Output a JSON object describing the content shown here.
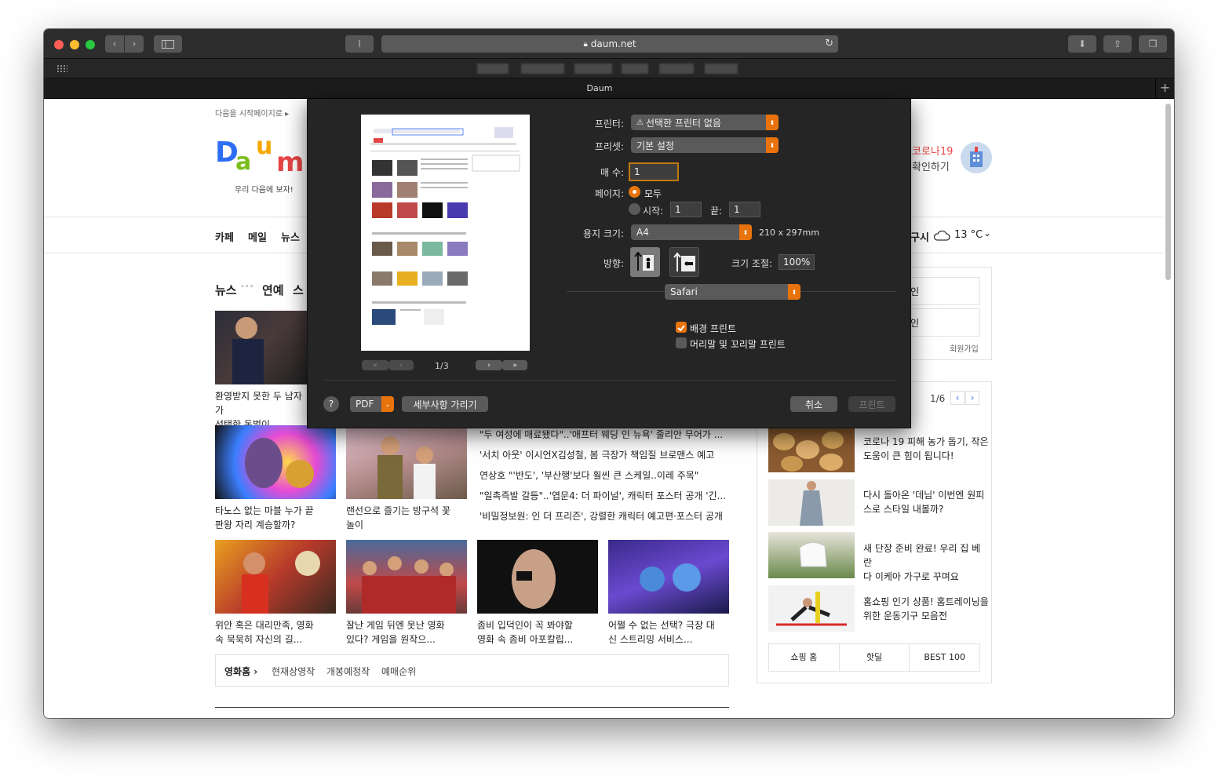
{
  "browser": {
    "address": "daum.net",
    "tab_title": "Daum",
    "new_tab_symbol": "+"
  },
  "daum": {
    "start_page_link": "다음을 시작페이지로",
    "slogan": "우리 다음에 보자!",
    "nav": [
      "카페",
      "메일",
      "뉴스"
    ],
    "covid_title": "코로나19",
    "covid_sub": "확인하기",
    "weather_city": "구시",
    "weather_temp": "13 °C",
    "section_tabs": [
      "뉴스",
      "연예",
      "스"
    ],
    "captions": [
      "환영받지 못한 두 남자가 선택한 돈벌이",
      "타노스 없는 마블 누가 끝판왕 자리 계승할까?",
      "랜선으로 즐기는 방구석 꽃놀이",
      "위안 혹은 대리만족, 영화 속 묵묵히 자신의 길...",
      "잘난 게임 뒤엔 못난 영화 있다? 게임을 원작으...",
      "좀비 입덕인이 꼭 봐야할 영화 속 좀비 아포칼립...",
      "어쩔 수 없는 선택? 극장 대신 스트리밍 서비스..."
    ],
    "caption1_line1": "환영받지 못한 두 남자가",
    "caption1_line2": "선택한 돈벌이",
    "caption2_line1": "타노스 없는 마블 누가 끝",
    "caption2_line2": "판왕 자리 계승할까?",
    "caption3_line1": "랜선으로 즐기는 방구석 꽃",
    "caption3_line2": "놀이",
    "caption4_line1": "위안 혹은 대리만족, 영화",
    "caption4_line2": "속 묵묵히 자신의 길...",
    "caption5_line1": "잘난 게임 뒤엔 못난 영화",
    "caption5_line2": "있다? 게임을 원작으...",
    "caption6_line1": "좀비 입덕인이 꼭 봐야할",
    "caption6_line2": "영화 속 좀비 아포칼립...",
    "caption7_line1": "어쩔 수 없는 선택? 극장 대",
    "caption7_line2": "신 스트리밍 서비스...",
    "news_lines": [
      "\"두 여성에 매료됐다\"..'애프터 웨딩 인 뉴욕' 줄리안 무어가 ...",
      "'서치 아웃' 이시언X김성철, 봄 극장가 책임질 브로맨스 예고",
      "연상호 \"'반도', '부산행'보다 훨씬 큰 스케일..이레 주목\"",
      "\"일촉즉발 갈등\"..'엽문4: 더 파이널', 캐릭터 포스터 공개 '긴...",
      "'비밀정보원: 인 더 프리즌', 강렬한 캐릭터 예고편·포스터 공개"
    ],
    "movie_home": "영화홈",
    "movie_links": [
      "현재상영작",
      "개봉예정작",
      "예매순위"
    ],
    "login_fragment_1": "인",
    "login_fragment_2": "인",
    "signup": "회원가입",
    "shop_pager": "1/6",
    "shop_items": [
      {
        "line1": "코로나 19 피해 농가 돕기, 작은",
        "line2": "도움이 큰 힘이 됩니다!"
      },
      {
        "line1": "다시 돌아온 '데님' 이번엔 원피",
        "line2": "스로 스타일 내볼까?"
      },
      {
        "line1": "새 단장 준비 완료! 우리 집 베란",
        "line2": "다 이케아 가구로 꾸며요"
      },
      {
        "line1": "홈쇼핑 인기 상품! 홈트레이닝을",
        "line2": "위한 운동기구 모음전"
      }
    ],
    "shop_tabs": [
      "쇼핑 홈",
      "핫딜",
      "BEST 100"
    ]
  },
  "print": {
    "printer_label": "프린터:",
    "printer_value": "선택한 프린터 없음",
    "preset_label": "프리셋:",
    "preset_value": "기본 설정",
    "copies_label": "매 수:",
    "copies_value": "1",
    "pages_label": "페이지:",
    "pages_all": "모두",
    "pages_from_label": "시작:",
    "pages_from": "1",
    "pages_to_label": "끝:",
    "pages_to": "1",
    "paper_label": "용지 크기:",
    "paper_value": "A4",
    "paper_dims": "210 x 297mm",
    "orientation_label": "방향:",
    "scale_label": "크기 조절:",
    "scale_value": "100%",
    "app_popup": "Safari",
    "print_backgrounds": "배경 프린트",
    "print_backgrounds_checked": true,
    "print_headers": "머리말 및 꼬리말 프린트",
    "print_headers_checked": false,
    "page_indicator": "1/3",
    "help": "?",
    "pdf": "PDF",
    "hide_details": "세부사항 가리기",
    "cancel": "취소",
    "print_button": "프린트",
    "accent": "#e8730c"
  }
}
